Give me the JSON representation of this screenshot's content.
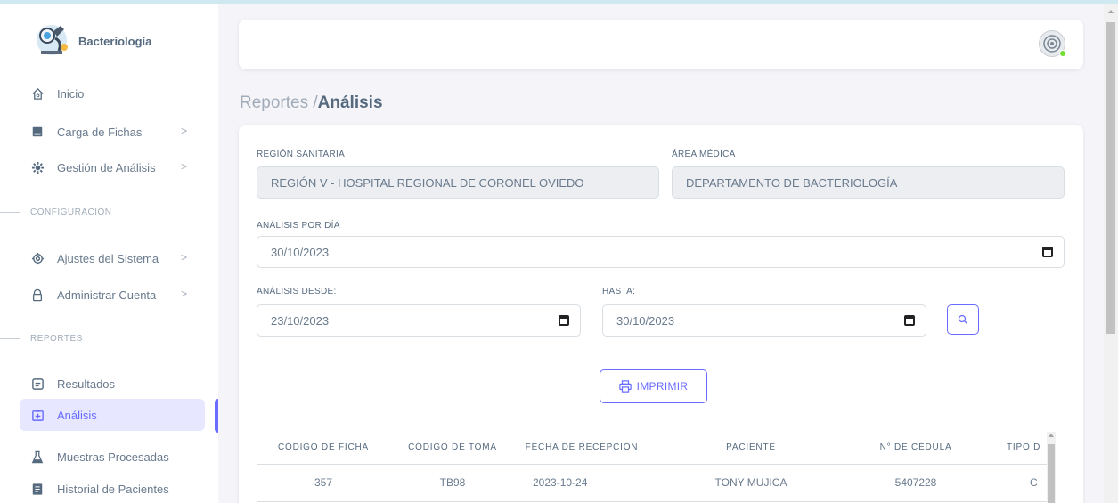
{
  "brand": {
    "name": "Bacteriología"
  },
  "sidebar": {
    "items": [
      {
        "label": "Inicio",
        "icon": "home-icon",
        "chevron": ""
      },
      {
        "label": "Carga de Fichas",
        "icon": "file-icon",
        "chevron": ">"
      },
      {
        "label": "Gestión de Análisis",
        "icon": "cog-icon",
        "chevron": ">"
      },
      {
        "label": "Ajustes del Sistema",
        "icon": "settings-icon",
        "chevron": ">"
      },
      {
        "label": "Administrar Cuenta",
        "icon": "lock-icon",
        "chevron": ">"
      },
      {
        "label": "Resultados",
        "icon": "message-icon",
        "chevron": ""
      },
      {
        "label": "Análisis",
        "icon": "clipboard-icon",
        "chevron": ""
      },
      {
        "label": "Muestras Procesadas",
        "icon": "flask-icon",
        "chevron": ""
      },
      {
        "label": "Historial de Pacientes",
        "icon": "book-icon",
        "chevron": ""
      }
    ],
    "sections": {
      "config": "CONFIGURACIÓN",
      "reports": "REPORTES"
    }
  },
  "page": {
    "breadcrumb": "Reportes /",
    "title": "Análisis"
  },
  "form": {
    "region_label": "REGIÓN SANITARIA",
    "region_value": "REGIÓN V - HOSPITAL REGIONAL DE CORONEL OVIEDO",
    "area_label": "ÁREA MÉDICA",
    "area_value": "DEPARTAMENTO DE BACTERIOLOGÍA",
    "day_label": "ANÁLISIS POR DÍA",
    "day_value": "30/10/2023",
    "from_label": "ANÁLISIS DESDE:",
    "from_value": "23/10/2023",
    "to_label": "HASTA:",
    "to_value": "30/10/2023",
    "print_label": "IMPRIMIR"
  },
  "table": {
    "headers": [
      "CÓDIGO DE FICHA",
      "CÓDIGO DE TOMA",
      "FECHA DE RECEPCIÓN",
      "PACIENTE",
      "N° DE CÉDULA",
      "TIPO D"
    ],
    "rows": [
      [
        "357",
        "TB98",
        "2023-10-24",
        "TONY MUJICA",
        "5407228",
        "C"
      ]
    ]
  },
  "colors": {
    "accent": "#696cff",
    "active_bg": "#e7e7ff",
    "status_online": "#71dd37"
  }
}
